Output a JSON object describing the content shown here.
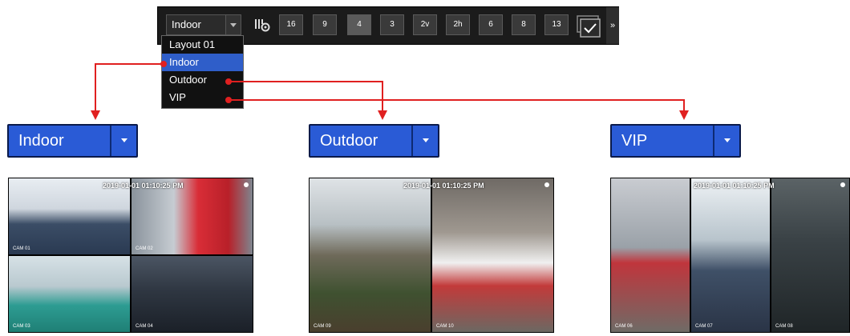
{
  "toolbar": {
    "selected_layout": "Indoor",
    "split_buttons": [
      "16",
      "9",
      "4",
      "3",
      "2v",
      "2h",
      "6",
      "8",
      "13"
    ],
    "active_split": "4",
    "more_label": "»"
  },
  "dropdown": {
    "items": [
      "Layout 01",
      "Indoor",
      "Outdoor",
      "VIP"
    ],
    "selected": "Indoor"
  },
  "previews": {
    "indoor": {
      "label": "Indoor",
      "timestamp": "2019-01-01 01:10:25 PM",
      "cams": [
        "CAM 01",
        "CAM 02",
        "CAM 03",
        "CAM 04"
      ]
    },
    "outdoor": {
      "label": "Outdoor",
      "timestamp": "2019-01-01 01:10:25 PM",
      "cams": [
        "CAM 09",
        "CAM 10"
      ]
    },
    "vip": {
      "label": "VIP",
      "timestamp": "2019-01-01 01:10:25 PM",
      "cams": [
        "CAM 06",
        "CAM 07",
        "CAM 08"
      ]
    }
  },
  "colors": {
    "accent": "#2a5bd6",
    "dropdown_highlight": "#2f5ec9",
    "arrow": "#e02020"
  }
}
